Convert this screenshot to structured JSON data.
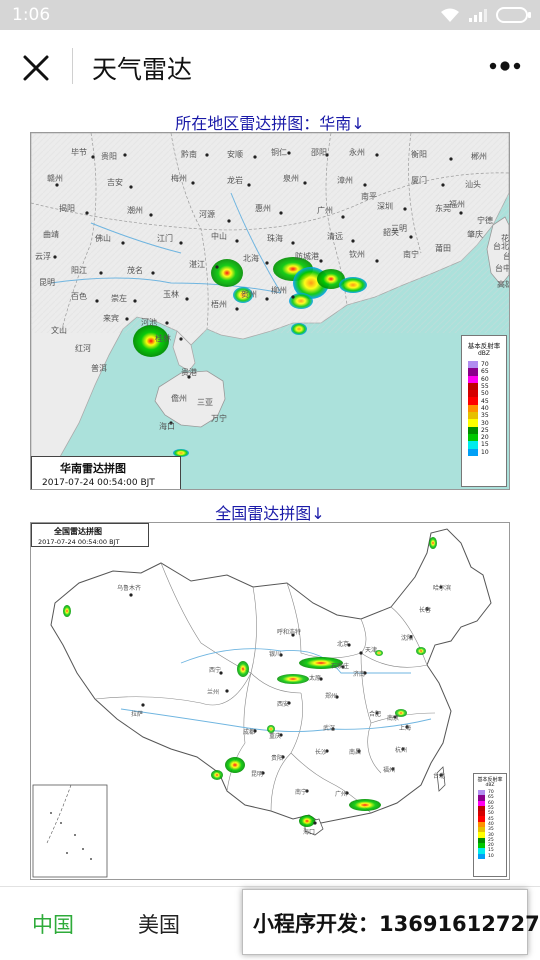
{
  "status_bar": {
    "time": "1:06"
  },
  "nav": {
    "title": "天气雷达"
  },
  "south_china": {
    "heading": "所在地区雷达拼图：华南↓",
    "stamp_title": "华南雷达拼图",
    "stamp_time": "2017-07-24 00:54:00 BJT",
    "legend_title": "基本反射率",
    "legend_unit": "dBZ",
    "legend": [
      {
        "value": "70",
        "color": "#b18ef0"
      },
      {
        "value": "65",
        "color": "#8b008b"
      },
      {
        "value": "60",
        "color": "#ff00f0"
      },
      {
        "value": "55",
        "color": "#c00000"
      },
      {
        "value": "50",
        "color": "#d60000"
      },
      {
        "value": "45",
        "color": "#ff0000"
      },
      {
        "value": "40",
        "color": "#ff9000"
      },
      {
        "value": "35",
        "color": "#e7c000"
      },
      {
        "value": "30",
        "color": "#ffff00"
      },
      {
        "value": "25",
        "color": "#008e00"
      },
      {
        "value": "20",
        "color": "#00c800"
      },
      {
        "value": "15",
        "color": "#00ecec"
      },
      {
        "value": "10",
        "color": "#01a0f6"
      }
    ],
    "labels": [
      "毕节",
      "贵阳",
      "黔南",
      "安顺",
      "铜仁",
      "邵阳",
      "永州",
      "衡阳",
      "郴州",
      "赣州",
      "吉安",
      "梅州",
      "龙岩",
      "泉州",
      "漳州",
      "厦门",
      "汕头",
      "揭阳",
      "潮州",
      "河源",
      "惠州",
      "广州",
      "深圳",
      "东莞",
      "佛山",
      "江门",
      "中山",
      "珠海",
      "清远",
      "韶关",
      "肇庆",
      "云浮",
      "阳江",
      "茂名",
      "湛江",
      "北海",
      "防城港",
      "钦州",
      "南宁",
      "百色",
      "崇左",
      "玉林",
      "梧州",
      "贺州",
      "柳州",
      "来宾",
      "河池",
      "桂林",
      "贵港",
      "海口",
      "三亚",
      "万宁",
      "儋州",
      "文山",
      "红河",
      "普洱",
      "昆明",
      "曲靖",
      "福州",
      "莆田",
      "三明",
      "南平",
      "宁德",
      "台北",
      "台中",
      "高雄",
      "台南",
      "花莲"
    ]
  },
  "national": {
    "heading": "全国雷达拼图↓",
    "stamp_title": "全国雷达拼图",
    "stamp_time": "2017-07-24 00:54:00 BJT",
    "legend_title": "基本反射率",
    "legend_unit": "dBZ",
    "legend_values": [
      "70",
      "65",
      "60",
      "55",
      "50",
      "45",
      "40",
      "35",
      "30",
      "25",
      "20",
      "15",
      "10"
    ],
    "labels": [
      "乌鲁木齐",
      "拉萨",
      "西宁",
      "兰州",
      "银川",
      "呼和浩特",
      "北京",
      "天津",
      "石家庄",
      "太原",
      "济南",
      "郑州",
      "西安",
      "成都",
      "重庆",
      "武汉",
      "长沙",
      "南昌",
      "合肥",
      "南京",
      "上海",
      "杭州",
      "福州",
      "广州",
      "南宁",
      "昆明",
      "贵阳",
      "海口",
      "沈阳",
      "长春",
      "哈尔滨",
      "台北"
    ]
  },
  "tabs": {
    "china": "中国",
    "usa": "美国"
  },
  "banner": {
    "text": "小程序开发：13691612727"
  },
  "colors": {
    "active_tab": "#2eab3a",
    "section_heading": "#1a1aa8",
    "sea": "#9fdcd6",
    "land": "#ececec"
  }
}
